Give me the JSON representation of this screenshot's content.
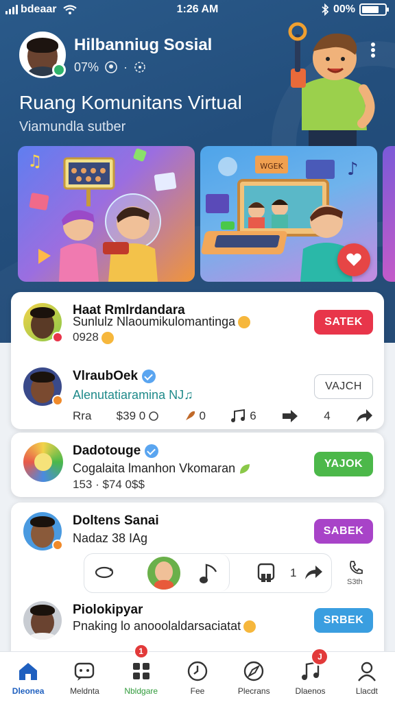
{
  "status_bar": {
    "carrier": "bdeaar",
    "time": "1:26 AM",
    "battery": "00%",
    "battery_level": 0.75
  },
  "profile": {
    "name": "Hilbanniug Sosial",
    "meta_percent": "07%",
    "meta_sep": "·"
  },
  "hero": {
    "title": "Ruang Komunitans Virtual",
    "subtitle": "Viamundla sutber"
  },
  "carousel": {
    "card1_screen_label": "",
    "card2_board_label": "WGEK"
  },
  "feed": [
    {
      "name": "Haat Rmlrdandara",
      "text": "Sunlulz Nlaoumikulomantinga",
      "stat": "0928",
      "button": "SATEK",
      "button_color": "#e8354a"
    },
    {
      "name": "VlraubOek",
      "text": "Alenutatiaramina NJ♫",
      "text_color": "#1f8a8a",
      "button": "VAJCH",
      "actions": [
        {
          "icon": "",
          "label": "Rra"
        },
        {
          "icon": "eye-icon",
          "label": "$39 0"
        },
        {
          "icon": "rocket-icon",
          "label": "0"
        },
        {
          "icon": "music-icon",
          "label": "6"
        },
        {
          "icon": "forward-icon",
          "label": ""
        },
        {
          "icon": "",
          "label": "4"
        },
        {
          "icon": "share-icon",
          "label": ""
        }
      ]
    },
    {
      "name": "Dadotouge",
      "text": "Cogalaita lmanhon Vkomaran",
      "stat": "153 · $74 0$$",
      "button": "YAJOK",
      "button_color": "#4cb84a"
    },
    {
      "name": "Doltens Sanai",
      "text": "Nadaz 38 IAg",
      "button": "SABEK",
      "button_color": "#a843c8",
      "player": {
        "count": "1",
        "side_label": "S3th"
      }
    },
    {
      "name": "Piolokipyar",
      "text": "Pnaking lo anooolaldarsaciatat",
      "button": "SRBEK",
      "button_color": "#3a9ee0"
    }
  ],
  "bottom_nav": [
    {
      "label": "Dleonea",
      "icon": "home-icon",
      "state": "active"
    },
    {
      "label": "Meldnta",
      "icon": "chat-icon",
      "state": ""
    },
    {
      "label": "Nbldgare",
      "icon": "grid-icon",
      "state": "green",
      "badge": "1"
    },
    {
      "label": "Fee",
      "icon": "clock-icon",
      "state": ""
    },
    {
      "label": "Plecrans",
      "icon": "compass-icon",
      "state": ""
    },
    {
      "label": "Dlaenos",
      "icon": "music-icon",
      "state": "",
      "badge": "J"
    },
    {
      "label": "Llacdt",
      "icon": "person-icon",
      "state": ""
    }
  ],
  "colors": {
    "header": "#234e7c",
    "active_nav": "#1e5fbf",
    "badge": "#e23a3a"
  }
}
